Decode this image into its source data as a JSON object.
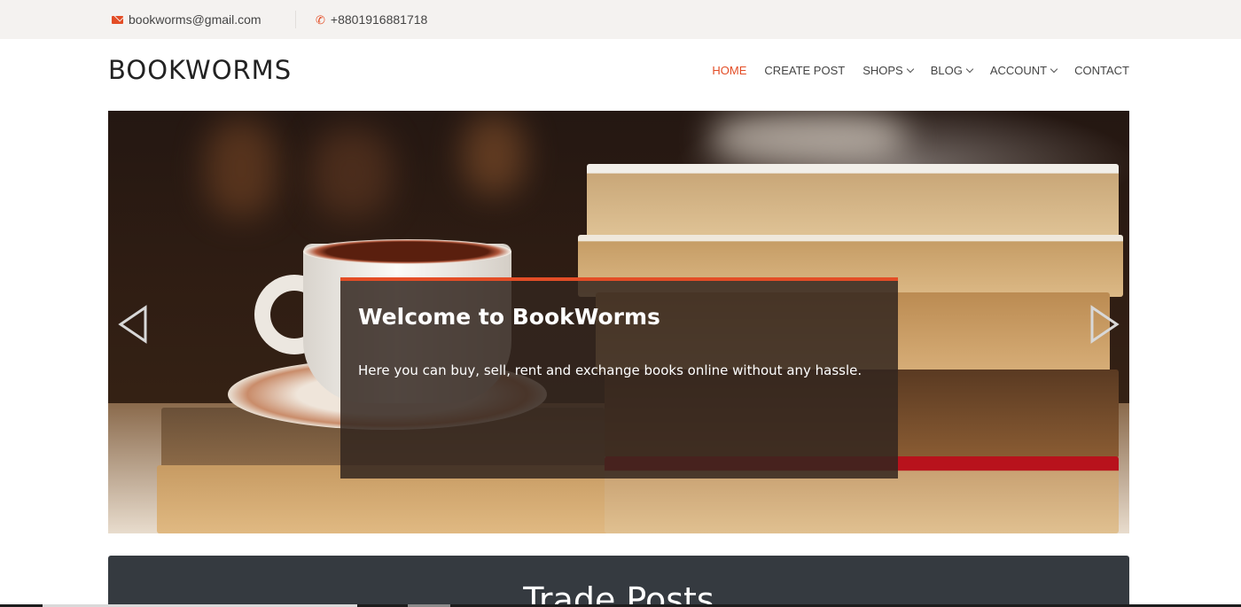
{
  "topbar": {
    "email": "bookworms@gmail.com",
    "phone": "+8801916881718",
    "email_icon": "envelope-icon",
    "phone_icon": "phone-icon"
  },
  "header": {
    "brand": "BOOKWORMS",
    "nav": [
      {
        "label": "HOME",
        "active": true,
        "dropdown": false
      },
      {
        "label": "CREATE POST",
        "active": false,
        "dropdown": false
      },
      {
        "label": "SHOPS",
        "active": false,
        "dropdown": true
      },
      {
        "label": "BLOG",
        "active": false,
        "dropdown": true
      },
      {
        "label": "ACCOUNT",
        "active": false,
        "dropdown": true
      },
      {
        "label": "CONTACT",
        "active": false,
        "dropdown": false
      }
    ]
  },
  "hero": {
    "title": "Welcome to BookWorms",
    "text": "Here you can buy, sell, rent and exchange books online without any hassle.",
    "prev_icon": "chevron-left-icon",
    "next_icon": "chevron-right-icon"
  },
  "trade": {
    "title": "Trade Posts"
  },
  "colors": {
    "accent": "#e34d26",
    "topbar_bg": "#f4f2f0",
    "section_bg": "#353a40"
  }
}
